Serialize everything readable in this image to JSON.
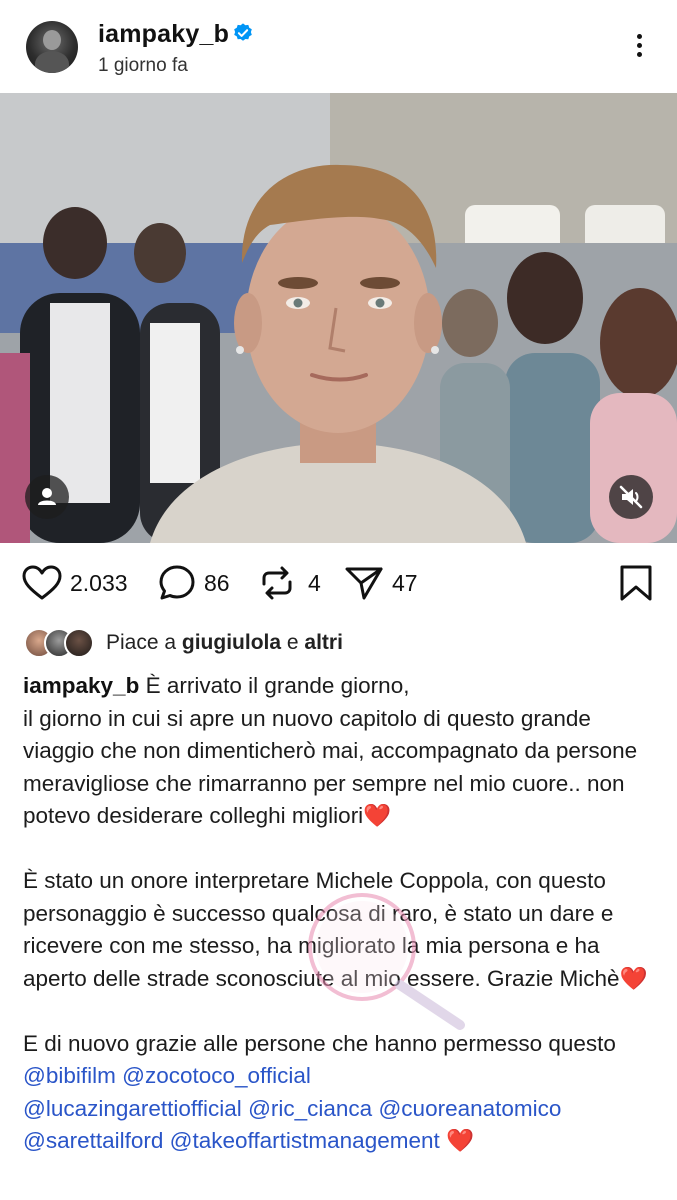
{
  "post": {
    "username": "iampaky_b",
    "time_ago": "1 giorno fa",
    "verified": true
  },
  "icons": {
    "verified": "verified-badge-icon",
    "more": "more-options-icon",
    "user_tag": "user-tag-icon",
    "mute": "muted-speaker-icon",
    "like": "heart-icon",
    "comment": "comment-icon",
    "repost": "repost-icon",
    "share": "send-icon",
    "save": "bookmark-icon"
  },
  "actions": {
    "likes": "2.033",
    "comments": "86",
    "reposts": "4",
    "shares": "47"
  },
  "liked_by": {
    "prefix": "Piace a ",
    "user": "giugiulola",
    "middle": " e ",
    "others": "altri"
  },
  "caption": {
    "username": "iampaky_b",
    "p1": " È arrivato il grande giorno,",
    "p2": "il giorno in cui si apre un nuovo capitolo di questo grande viaggio che non dimenticherò mai, accompagnato da persone meravigliose che rimarranno per sempre nel mio cuore.. non potevo desiderare colleghi migliori",
    "p3": "È stato un onore interpretare Michele Coppola, con questo personaggio è successo qualcosa di raro, è stato un dare e ricevere con me stesso, ha migliorato la mia persona e ha aperto delle strade sconosciute al mio essere. Grazie Michè",
    "p4": "E di nuovo grazie alle persone che hanno permesso questo ",
    "mentions": [
      "@bibifilm",
      "@zocotoco_official",
      "@lucazingarettiofficial",
      "@ric_cianca",
      "@cuoreanatomico",
      "@sarettailford",
      "@takeoffartistmanagement"
    ],
    "heart": "❤️"
  },
  "colors": {
    "verified_blue": "#0095f6",
    "mention_blue": "#2a55c8",
    "heart_red": "#e0242f"
  }
}
